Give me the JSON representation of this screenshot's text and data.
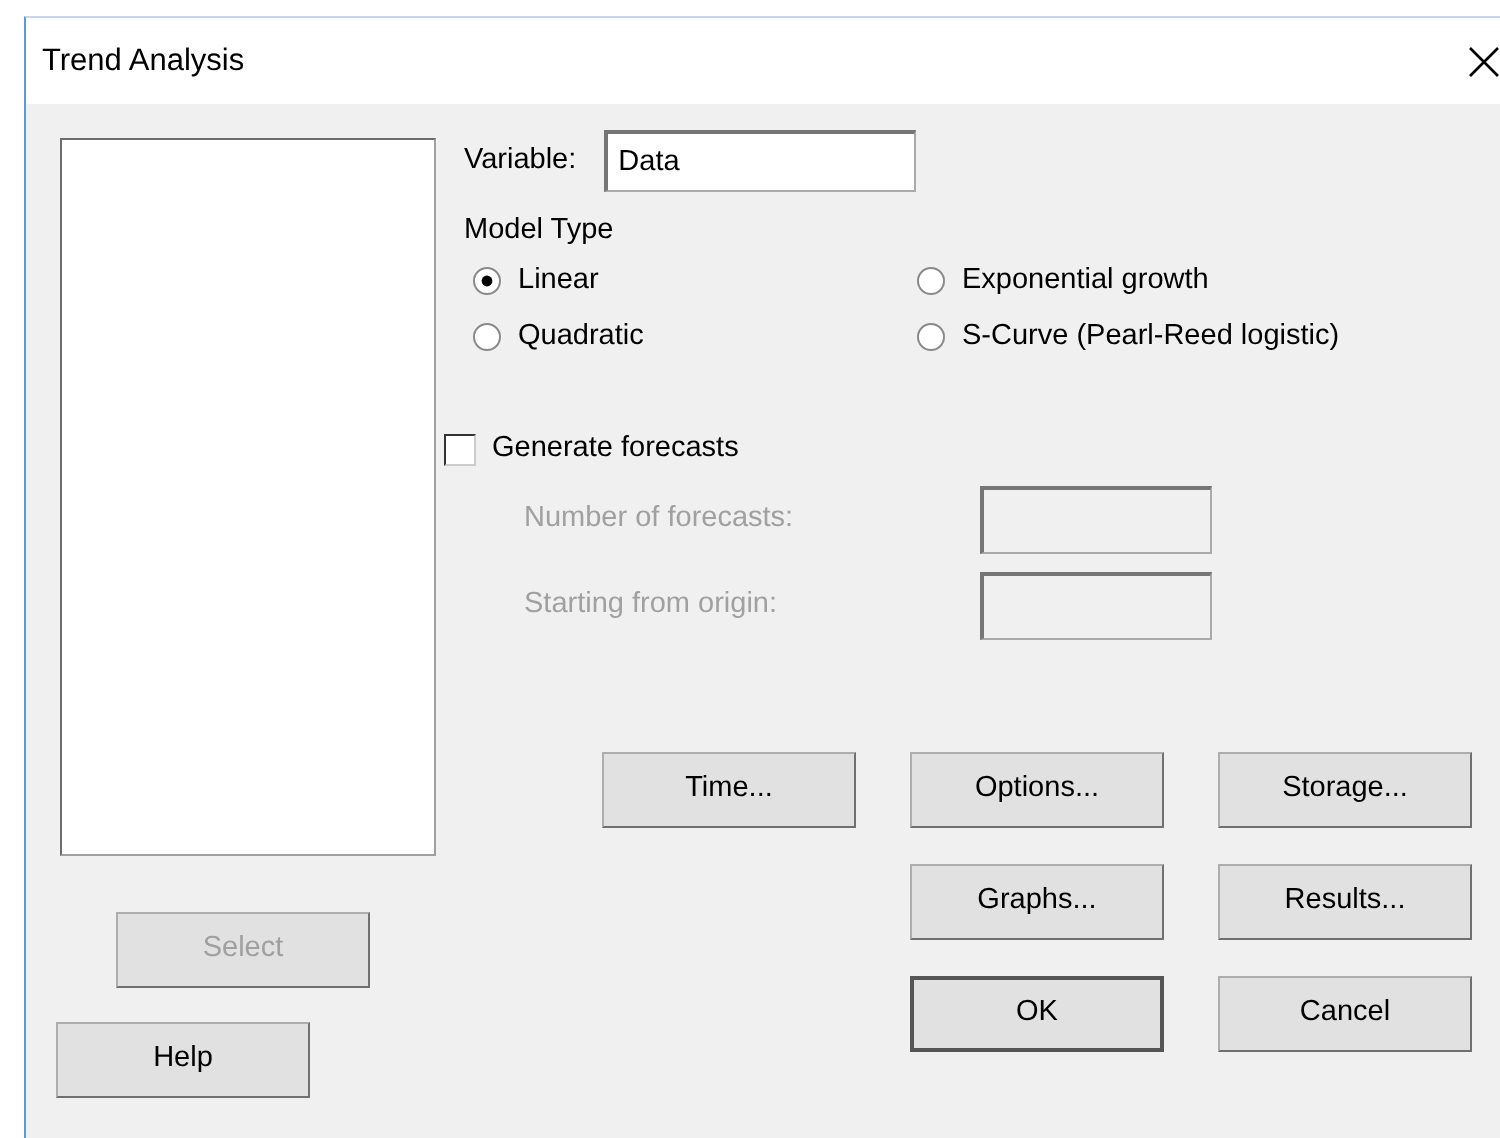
{
  "window": {
    "title": "Trend Analysis"
  },
  "variable": {
    "label": "Variable:",
    "value": "Data"
  },
  "model_type": {
    "label": "Model Type",
    "options": [
      {
        "label": "Linear",
        "selected": true
      },
      {
        "label": "Exponential growth",
        "selected": false
      },
      {
        "label": "Quadratic",
        "selected": false
      },
      {
        "label": "S-Curve (Pearl-Reed logistic)",
        "selected": false
      }
    ]
  },
  "generate_forecasts": {
    "label": "Generate forecasts",
    "checked": false
  },
  "forecast_fields": [
    {
      "label": "Number of forecasts:",
      "disabled": true
    },
    {
      "label": "Starting from origin:",
      "disabled": true
    }
  ],
  "side_buttons": [
    {
      "label": "Select",
      "disabled": true
    },
    {
      "label": "Help",
      "disabled": false
    }
  ],
  "action_buttons": [
    [
      {
        "label": "Time...",
        "default": false
      },
      {
        "label": "Options...",
        "default": false
      },
      {
        "label": "Storage...",
        "default": false
      }
    ],
    [
      {
        "label": "Graphs...",
        "default": false
      },
      {
        "label": "Results...",
        "default": false
      }
    ],
    [
      {
        "label": "OK",
        "default": true
      },
      {
        "label": "Cancel",
        "default": false
      }
    ]
  ]
}
